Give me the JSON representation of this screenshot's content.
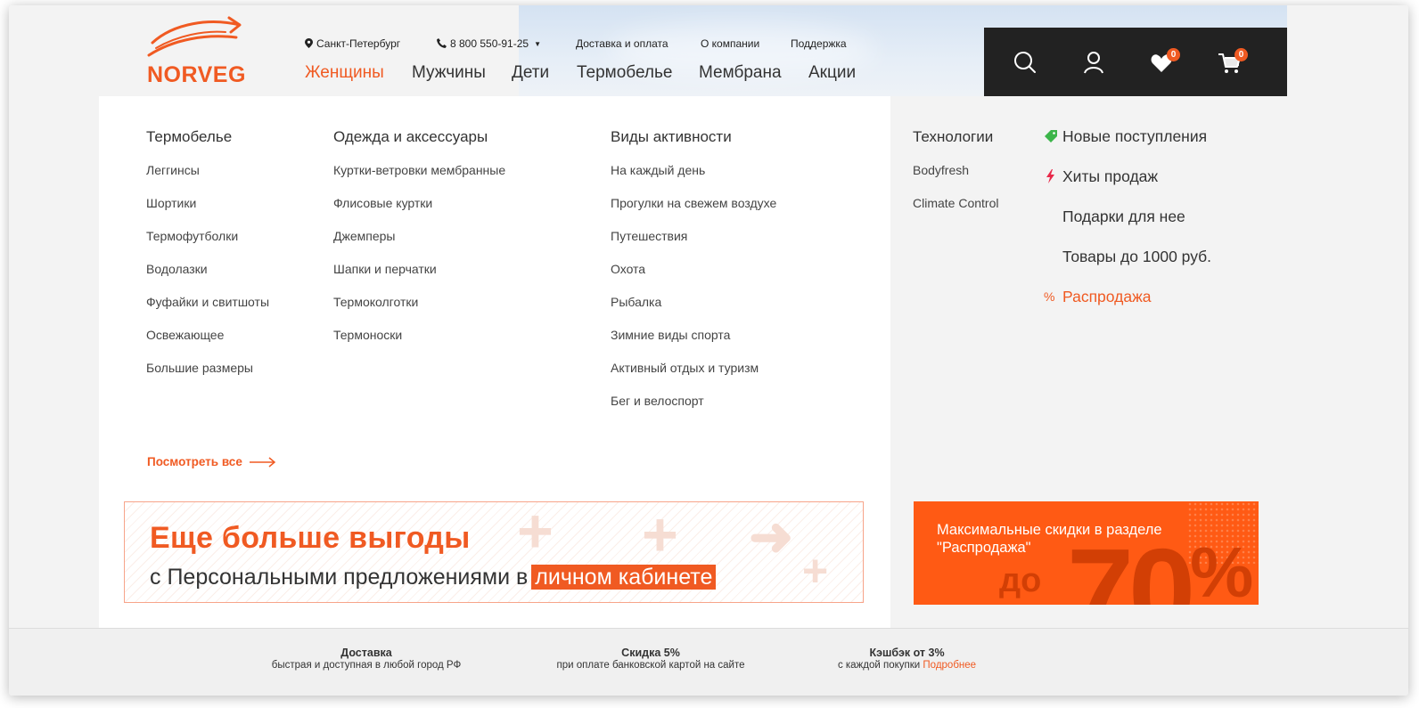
{
  "header": {
    "logo_text": "NORVEG",
    "city": "Санкт-Петербург",
    "phone": "8 800 550-91-25",
    "top_links": [
      "Доставка и оплата",
      "О компании",
      "Поддержка"
    ],
    "nav": [
      "Женщины",
      "Мужчины",
      "Дети",
      "Термобелье",
      "Мембрана",
      "Акции"
    ],
    "active_nav": "Женщины",
    "favorites_count": "0",
    "cart_count": "0"
  },
  "menu": {
    "columns": [
      {
        "title": "Термобелье",
        "items": [
          "Леггинсы",
          "Шортики",
          "Термофутболки",
          "Водолазки",
          "Фуфайки и свитшоты",
          "Освежающее",
          "Большие размеры"
        ]
      },
      {
        "title": "Одежда и аксессуары",
        "items": [
          "Куртки-ветровки мембранные",
          "Флисовые куртки",
          "Джемперы",
          "Шапки и перчатки",
          "Термоколготки",
          "Термоноски"
        ]
      },
      {
        "title": "Виды активности",
        "items": [
          "На каждый день",
          "Прогулки на свежем воздухе",
          "Путешествия",
          "Охота",
          "Рыбалка",
          "Зимние виды спорта",
          "Активный отдых и туризм",
          "Бег и велоспорт"
        ]
      },
      {
        "title": "Технологии",
        "items": [
          "Bodyfresh",
          "Climate Control"
        ]
      }
    ],
    "see_all": "Посмотреть все",
    "specials": [
      {
        "label": "Новые поступления",
        "icon": "tag-icon",
        "color": "#3cb54a"
      },
      {
        "label": "Хиты продаж",
        "icon": "lightning-icon",
        "color": "#e8294a"
      },
      {
        "label": "Подарки для нее",
        "icon": "",
        "color": ""
      },
      {
        "label": "Товары до 1000 руб.",
        "icon": "",
        "color": ""
      },
      {
        "label": "Распродажа",
        "icon": "percent-icon",
        "color": "#f05a22"
      }
    ]
  },
  "promo": {
    "title": "Еще больше выгоды",
    "subtitle": "с Персональными предложениями в",
    "highlight": "личном кабинете"
  },
  "sale_banner": {
    "text": "Максимальные скидки в разделе \"Распродажа\"",
    "big_prefix": "до",
    "big_value": "70",
    "big_symbol": "%"
  },
  "footer": [
    {
      "title": "Доставка",
      "text": "быстрая и доступная в любой город РФ",
      "link": ""
    },
    {
      "title": "Скидка 5%",
      "text": "при оплате банковской картой на сайте",
      "link": ""
    },
    {
      "title": "Кэшбэк от 3%",
      "text": "с каждой покупки",
      "link": "Подробнее"
    }
  ],
  "colors": {
    "accent": "#f05a22",
    "dark_bar": "#222222",
    "sale_bg": "#ff5a14"
  }
}
